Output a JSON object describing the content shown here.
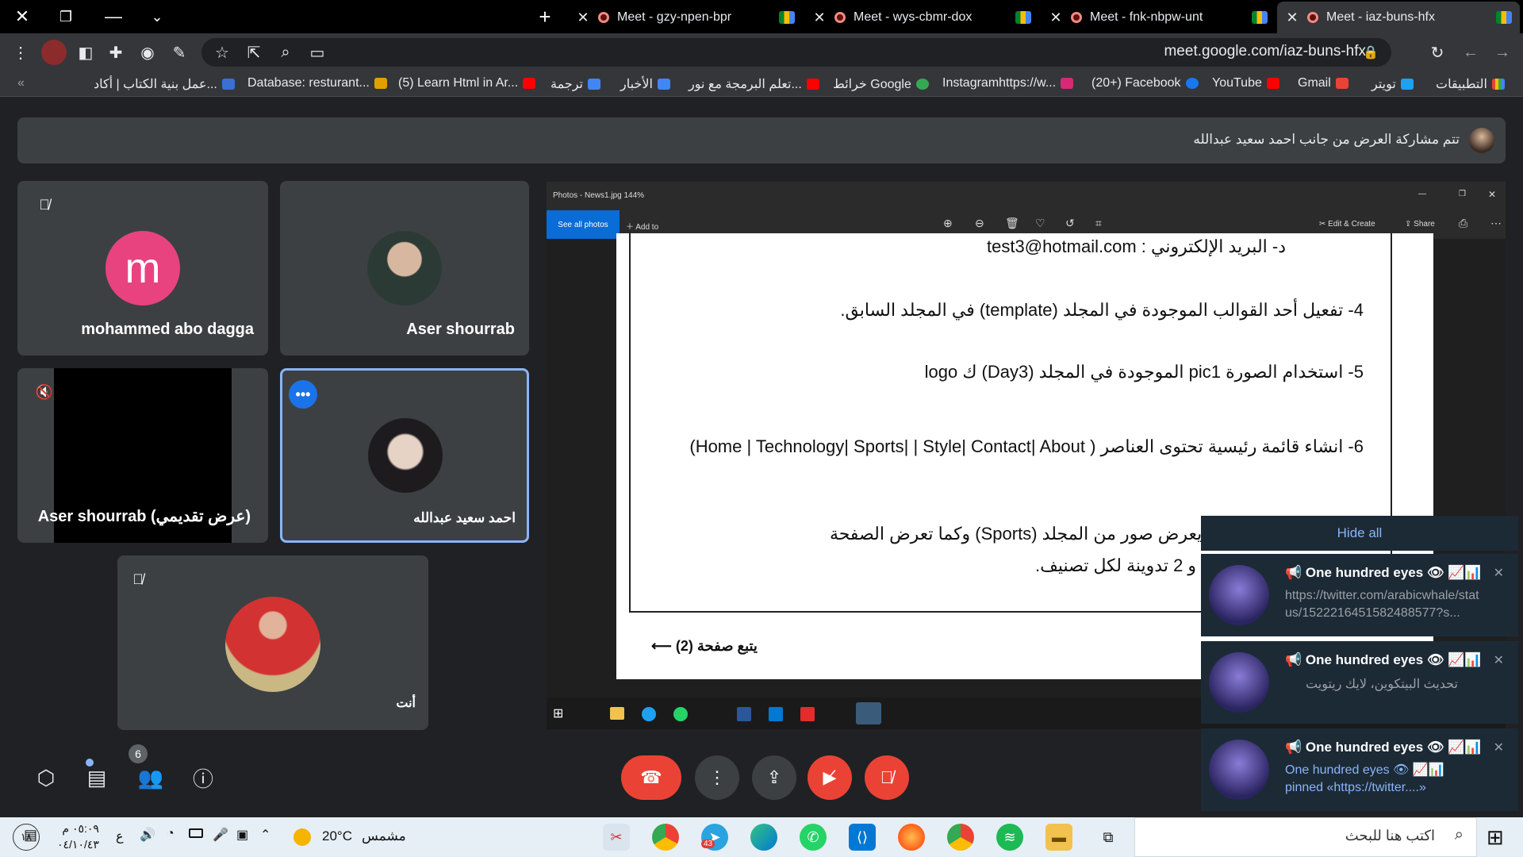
{
  "browser": {
    "tabs": [
      {
        "title": "Meet - gzy-npen-bpr"
      },
      {
        "title": "Meet - wys-cbmr-dox"
      },
      {
        "title": "Meet - fnk-nbpw-unt"
      },
      {
        "title": "Meet - iaz-buns-hfx"
      }
    ],
    "url": "meet.google.com/iaz-buns-hfx",
    "bookmarks": [
      "التطبيقات",
      "تويتر",
      "Gmail",
      "YouTube",
      "(20+) Facebook",
      "Instagramhttps://w...",
      "خرائط Google",
      "تعلم البرمجة مع نور...",
      "الأخبار",
      "ترجمة",
      "(5) Learn Html in Ar...",
      "Database: resturant...",
      "عمل بنية الكتاب | أكاد..."
    ]
  },
  "meet": {
    "banner_text": "تتم مشاركة العرض من جانب احمد سعيد عبدالله",
    "participants": {
      "p1": {
        "name": "mohammed abo dagga",
        "initial": "m"
      },
      "p2": {
        "name": "Aser shourrab"
      },
      "p3": {
        "name": "Aser shourrab (عرض تقديمي)"
      },
      "p4": {
        "name": "احمد سعيد عبدالله"
      },
      "p5": {
        "name": "أنت"
      }
    },
    "people_count": "6"
  },
  "shared_screen": {
    "photos_title": "Photos - News1.jpg   144%",
    "see_all": "See all photos",
    "add_to": "Add to",
    "edit_create": "Edit & Create",
    "share": "Share",
    "doc_lines": {
      "l1": "د-   البريد الإلكتروني :  test3@hotmail.com",
      "l2": "4- تفعيل أحد القوالب الموجودة في المجلد (template) في المجلد السابق.",
      "l3": "5- استخدام الصورة pic1 الموجودة في المجلد (Day3) ك logo",
      "l4": "6- انشاء قائمة رئيسية تحتوى العناصر ( Home | Technology| Sports| | Style| Contact| About)",
      "l5": "(Home) بحيث تحتوى سلايدر يعرض صور من المجلد (Sports) وكما تعرض الصفحة",
      "l6": "التالية (fsahion, SportNews) و 2 تدوينة لكل تصنيف.",
      "l7": "يتبع صفحة (2)"
    }
  },
  "notifications": {
    "hide_all": "Hide all",
    "items": [
      {
        "title": "📢 One hundred eyes 👁 📈📊",
        "body": "https://twitter.com/arabicwhale/status/1522216451582488577?s..."
      },
      {
        "title": "📢 One hundred eyes 👁 📈📊",
        "body": "تحديث البيتكوين، لايك ريتويت"
      },
      {
        "title": "📢 One hundred eyes 👁 📈📊",
        "body": "One hundred eyes 👁 📈📊 pinned «https://twitter....»"
      }
    ]
  },
  "taskbar": {
    "search_placeholder": "اكتب هنا للبحث",
    "weather_temp": "20°C",
    "weather_text": "مشمس",
    "time": "٠٥:٠٩ م",
    "date": "٠٤/١٠/٤٣",
    "lang": "ع",
    "notif_count": "١٨",
    "telegram_badge": "43"
  }
}
